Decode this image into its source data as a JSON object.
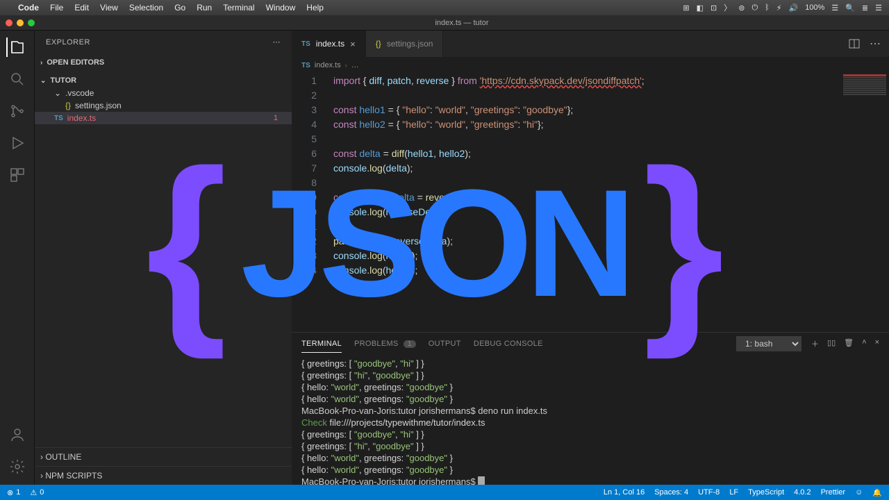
{
  "mac": {
    "app": "Code",
    "menus": [
      "File",
      "Edit",
      "View",
      "Selection",
      "Go",
      "Run",
      "Terminal",
      "Window",
      "Help"
    ],
    "right": [
      "🔲",
      "⊡",
      "≡",
      "◧",
      "ᯅ",
      "〉",
      "⊚",
      "⏻",
      "ᛒ",
      "⚡︎",
      "🔊",
      "100%",
      "☰",
      "🔍",
      "≣",
      "☰"
    ]
  },
  "titlebar": {
    "title": "index.ts — tutor"
  },
  "sidebar": {
    "title": "EXPLORER",
    "sections": {
      "open_editors": "OPEN EDITORS",
      "project": "TUTOR",
      "outline": "OUTLINE",
      "npm": "NPM SCRIPTS"
    },
    "tree": {
      "vscode": ".vscode",
      "settings": "settings.json",
      "index": "index.ts",
      "index_decoration": "1"
    }
  },
  "tabs": {
    "index": "index.ts",
    "settings": "settings.json"
  },
  "breadcrumb": {
    "file": "index.ts",
    "more": "…"
  },
  "code": {
    "lines": [
      {
        "n": 1,
        "segs": [
          [
            "kw",
            "import "
          ],
          [
            "plain",
            "{ "
          ],
          [
            "id",
            "diff"
          ],
          [
            "plain",
            ", "
          ],
          [
            "id",
            "patch"
          ],
          [
            "plain",
            ", "
          ],
          [
            "id",
            "reverse"
          ],
          [
            "plain",
            " } "
          ],
          [
            "kw",
            "from "
          ],
          [
            "str",
            "'https://cdn.skypack.dev/jsondiffpatch'"
          ],
          [
            "plain",
            ";"
          ]
        ],
        "err": true
      },
      {
        "n": 2,
        "segs": [
          [
            "plain",
            ""
          ]
        ]
      },
      {
        "n": 3,
        "segs": [
          [
            "kw",
            "const "
          ],
          [
            "const",
            "hello1"
          ],
          [
            "plain",
            " = { "
          ],
          [
            "str",
            "\"hello\""
          ],
          [
            "plain",
            ": "
          ],
          [
            "str",
            "\"world\""
          ],
          [
            "plain",
            ", "
          ],
          [
            "str",
            "\"greetings\""
          ],
          [
            "plain",
            ": "
          ],
          [
            "str",
            "\"goodbye\""
          ],
          [
            "plain",
            "};"
          ]
        ]
      },
      {
        "n": 4,
        "segs": [
          [
            "kw",
            "const "
          ],
          [
            "const",
            "hello2"
          ],
          [
            "plain",
            " = { "
          ],
          [
            "str",
            "\"hello\""
          ],
          [
            "plain",
            ": "
          ],
          [
            "str",
            "\"world\""
          ],
          [
            "plain",
            ", "
          ],
          [
            "str",
            "\"greetings\""
          ],
          [
            "plain",
            ": "
          ],
          [
            "str",
            "\"hi\""
          ],
          [
            "plain",
            "};"
          ]
        ]
      },
      {
        "n": 5,
        "segs": [
          [
            "plain",
            ""
          ]
        ]
      },
      {
        "n": 6,
        "segs": [
          [
            "kw",
            "const "
          ],
          [
            "const",
            "delta"
          ],
          [
            "plain",
            " = "
          ],
          [
            "fn",
            "diff"
          ],
          [
            "plain",
            "("
          ],
          [
            "id",
            "hello1"
          ],
          [
            "plain",
            ", "
          ],
          [
            "id",
            "hello2"
          ],
          [
            "plain",
            ");"
          ]
        ]
      },
      {
        "n": 7,
        "segs": [
          [
            "id",
            "console"
          ],
          [
            "plain",
            "."
          ],
          [
            "fn",
            "log"
          ],
          [
            "plain",
            "("
          ],
          [
            "id",
            "delta"
          ],
          [
            "plain",
            ");"
          ]
        ]
      },
      {
        "n": 8,
        "segs": [
          [
            "plain",
            ""
          ]
        ]
      },
      {
        "n": 9,
        "segs": [
          [
            "kw",
            "const "
          ],
          [
            "const",
            "reverseDelta"
          ],
          [
            "plain",
            " = "
          ],
          [
            "fn",
            "reverse"
          ],
          [
            "plain",
            "("
          ],
          [
            "id",
            "delta"
          ],
          [
            "plain",
            ");"
          ]
        ]
      },
      {
        "n": 10,
        "segs": [
          [
            "id",
            "console"
          ],
          [
            "plain",
            "."
          ],
          [
            "fn",
            "log"
          ],
          [
            "plain",
            "("
          ],
          [
            "id",
            "reverseDelta"
          ],
          [
            "plain",
            ");"
          ]
        ]
      },
      {
        "n": 11,
        "segs": [
          [
            "plain",
            ""
          ]
        ]
      },
      {
        "n": 12,
        "segs": [
          [
            "fn",
            "patch"
          ],
          [
            "plain",
            "("
          ],
          [
            "id",
            "hello2"
          ],
          [
            "plain",
            ", "
          ],
          [
            "id",
            "reverseDelta"
          ],
          [
            "plain",
            ");"
          ]
        ]
      },
      {
        "n": 13,
        "segs": [
          [
            "id",
            "console"
          ],
          [
            "plain",
            "."
          ],
          [
            "fn",
            "log"
          ],
          [
            "plain",
            "("
          ],
          [
            "id",
            "hello1"
          ],
          [
            "plain",
            ");"
          ]
        ]
      },
      {
        "n": 14,
        "segs": [
          [
            "id",
            "console"
          ],
          [
            "plain",
            "."
          ],
          [
            "fn",
            "log"
          ],
          [
            "plain",
            "("
          ],
          [
            "id",
            "hello2"
          ],
          [
            "plain",
            ");"
          ]
        ]
      }
    ]
  },
  "panel": {
    "tabs": {
      "terminal": "TERMINAL",
      "problems": "PROBLEMS",
      "problems_count": "1",
      "output": "OUTPUT",
      "debug": "DEBUG CONSOLE"
    },
    "shell": "1: bash",
    "terminal_lines": [
      [
        [
          "key",
          "{ greetings: [ "
        ],
        [
          "str",
          "\"goodbye\""
        ],
        [
          "key",
          ", "
        ],
        [
          "str",
          "\"hi\""
        ],
        [
          "key",
          " ] }"
        ]
      ],
      [
        [
          "key",
          "{ greetings: [ "
        ],
        [
          "str",
          "\"hi\""
        ],
        [
          "key",
          ", "
        ],
        [
          "str",
          "\"goodbye\""
        ],
        [
          "key",
          " ] }"
        ]
      ],
      [
        [
          "key",
          "{ hello: "
        ],
        [
          "str",
          "\"world\""
        ],
        [
          "key",
          ", greetings: "
        ],
        [
          "str",
          "\"goodbye\""
        ],
        [
          "key",
          " }"
        ]
      ],
      [
        [
          "key",
          "{ hello: "
        ],
        [
          "str",
          "\"world\""
        ],
        [
          "key",
          ", greetings: "
        ],
        [
          "str",
          "\"goodbye\""
        ],
        [
          "key",
          " }"
        ]
      ],
      [
        [
          "prompt",
          "MacBook-Pro-van-Joris:tutor jorishermans$ deno run index.ts"
        ]
      ],
      [
        [
          "check",
          "Check "
        ],
        [
          "key",
          "file:///projects/typewithme/tutor/index.ts"
        ]
      ],
      [
        [
          "key",
          "{ greetings: [ "
        ],
        [
          "str",
          "\"goodbye\""
        ],
        [
          "key",
          ", "
        ],
        [
          "str",
          "\"hi\""
        ],
        [
          "key",
          " ] }"
        ]
      ],
      [
        [
          "key",
          "{ greetings: [ "
        ],
        [
          "str",
          "\"hi\""
        ],
        [
          "key",
          ", "
        ],
        [
          "str",
          "\"goodbye\""
        ],
        [
          "key",
          " ] }"
        ]
      ],
      [
        [
          "key",
          "{ hello: "
        ],
        [
          "str",
          "\"world\""
        ],
        [
          "key",
          ", greetings: "
        ],
        [
          "str",
          "\"goodbye\""
        ],
        [
          "key",
          " }"
        ]
      ],
      [
        [
          "key",
          "{ hello: "
        ],
        [
          "str",
          "\"world\""
        ],
        [
          "key",
          ", greetings: "
        ],
        [
          "str",
          "\"goodbye\""
        ],
        [
          "key",
          " }"
        ]
      ],
      [
        [
          "prompt",
          "MacBook-Pro-van-Joris:tutor jorishermans$ "
        ],
        [
          "cursor",
          "▌"
        ]
      ]
    ]
  },
  "status": {
    "errors": "1",
    "warnings": "0",
    "cursor": "Ln 1, Col 16",
    "spaces": "Spaces: 4",
    "encoding": "UTF-8",
    "eol": "LF",
    "lang": "TypeScript",
    "tsver": "4.0.2",
    "prettier": "Prettier",
    "feedback": "☺",
    "bell": "🔔"
  },
  "overlay": {
    "left_brace": "{",
    "word": "JSON",
    "right_brace": "}"
  }
}
